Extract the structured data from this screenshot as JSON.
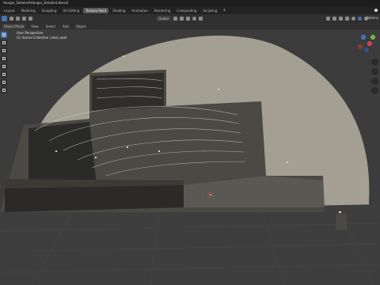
{
  "window": {
    "title": "Hangar_Detailed\\Hangar_Detailed.blend]"
  },
  "workspace_tabs": [
    "Layout",
    "Modeling",
    "Sculpting",
    "UV Editing",
    "Texture Paint",
    "Shading",
    "Animation",
    "Rendering",
    "Compositing",
    "Scripting"
  ],
  "active_tab": "Texture Paint",
  "header": {
    "mode": "Object Mode",
    "menus": [
      "View",
      "Select",
      "Add",
      "Object"
    ],
    "orientation": "Global",
    "options": "Options"
  },
  "viewport": {
    "perspective": "User Perspective",
    "collection": "(1) Scene Collection | door_wall"
  },
  "gizmo": {
    "x": "X",
    "y": "Y",
    "z": "Z"
  },
  "colors": {
    "accent": "#4772b3",
    "header": "#303030",
    "ground": "#3e3e3e"
  }
}
